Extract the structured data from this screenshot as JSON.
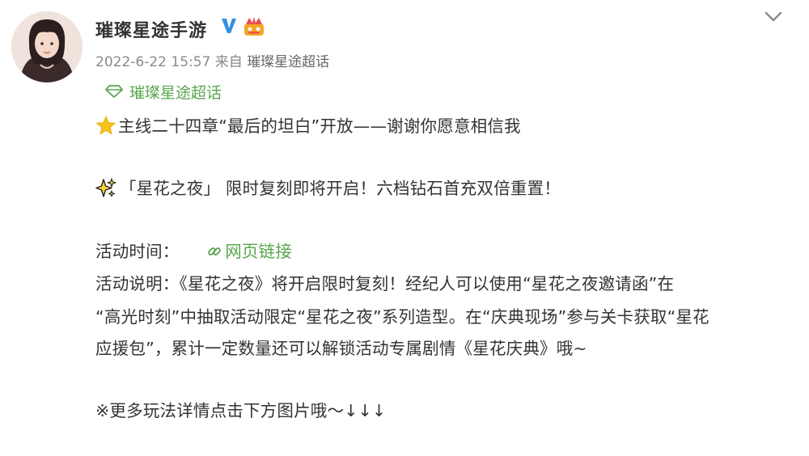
{
  "post": {
    "username": "璀璨星途手游",
    "timestamp": "2022-6-22 15:57",
    "source_prefix": "来自",
    "source_name": "璀璨星途超话",
    "topic_label": "璀璨星途超话",
    "lines": [
      "主线二十四章“最后的坦白”开放——谢谢你愿意相信我",
      "「星花之夜」 限时复刻即将开启！六档钻石首充双倍重置！",
      "活动时间：",
      "活动说明：《星花之夜》将开启限时复刻！经纪人可以使用“星花之夜邀请函”在",
      "“高光时刻”中抽取活动限定“星花之夜”系列造型。在“庆典现场”参与关卡获取“星花",
      "应援包”，累计一定数量还可以解锁活动专属剧情《星花庆典》哦~",
      "※更多玩法详情点击下方图片哦～↓↓↓"
    ],
    "web_link_label": "网页链接"
  },
  "icons": {
    "verified": "verified-v-icon",
    "vip": "vip-crown-badge-icon",
    "chevron": "chevron-down-icon",
    "topic": "super-topic-diamond-icon",
    "star": "star-emoji-icon",
    "sparkle": "sparkle-emoji-icon",
    "link": "link-icon"
  },
  "colors": {
    "accent_green": "#58a64e",
    "verified_blue": "#2f8fe6",
    "meta_gray": "#8a8a8a",
    "text": "#333333"
  }
}
